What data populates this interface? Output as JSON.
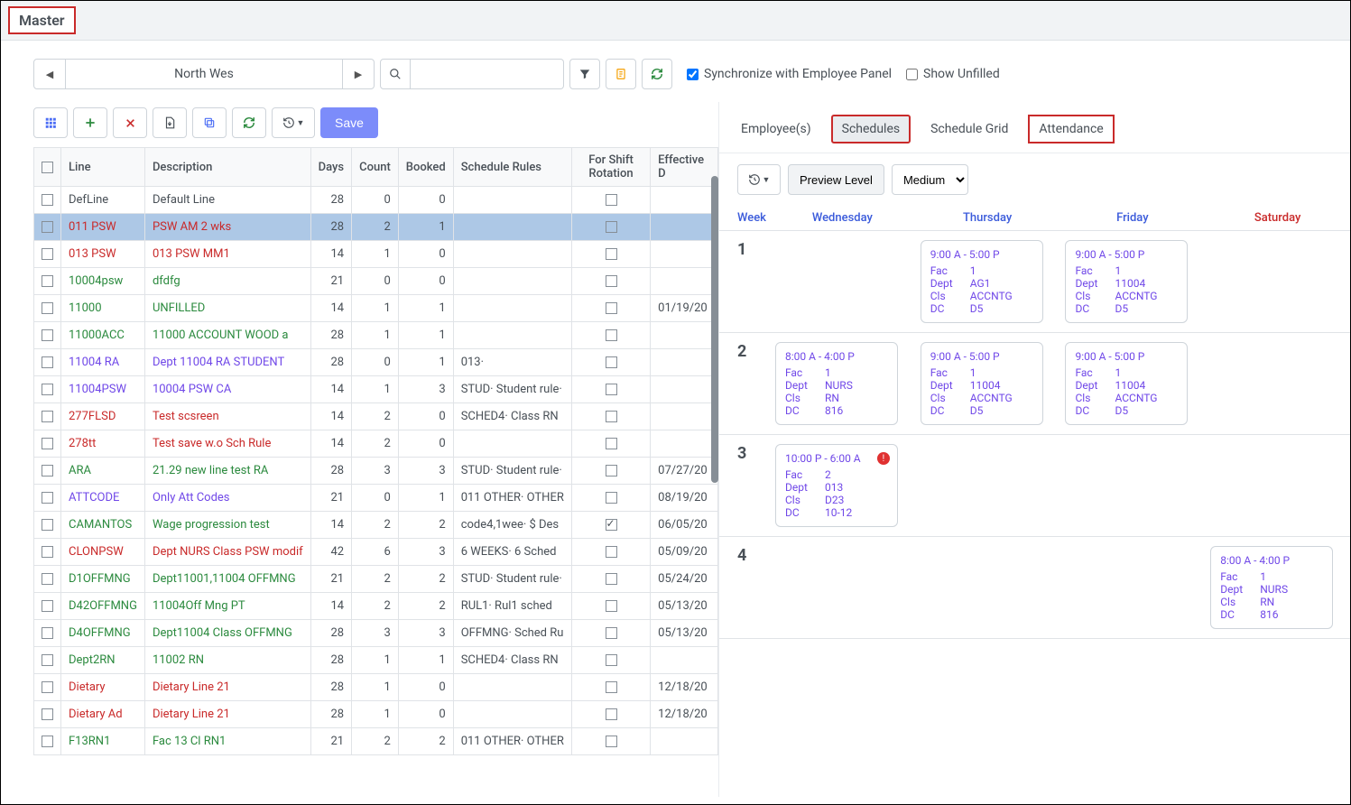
{
  "title": "Master",
  "site": "North Wes",
  "sync_label": "Synchronize with Employee Panel",
  "unfilled_label": "Show Unfilled",
  "save_label": "Save",
  "grid": {
    "headers": [
      "",
      "Line",
      "Description",
      "Days",
      "Count",
      "Booked",
      "Schedule Rules",
      "For Shift Rotation",
      "Effective D"
    ],
    "rows": [
      {
        "sel": false,
        "line": "DefLine",
        "desc": "Default Line",
        "days": 28,
        "count": 0,
        "booked": 0,
        "rules": "",
        "rot": false,
        "eff": "",
        "color": "default"
      },
      {
        "sel": true,
        "line": "011 PSW",
        "desc": "PSW AM 2 wks",
        "days": 28,
        "count": 2,
        "booked": 1,
        "rules": "",
        "rot": false,
        "eff": "",
        "color": "red"
      },
      {
        "sel": false,
        "line": "013 PSW",
        "desc": "013 PSW MM1",
        "days": 14,
        "count": 1,
        "booked": 0,
        "rules": "",
        "rot": false,
        "eff": "",
        "color": "red"
      },
      {
        "sel": false,
        "line": "10004psw",
        "desc": "dfdfg",
        "days": 21,
        "count": 0,
        "booked": 0,
        "rules": "",
        "rot": false,
        "eff": "",
        "color": "green"
      },
      {
        "sel": false,
        "line": "11000",
        "desc": "UNFILLED",
        "days": 14,
        "count": 1,
        "booked": 1,
        "rules": "",
        "rot": false,
        "eff": "01/19/20",
        "color": "green"
      },
      {
        "sel": false,
        "line": "11000ACC",
        "desc": "11000 ACCOUNT WOOD a",
        "days": 28,
        "count": 1,
        "booked": 1,
        "rules": "",
        "rot": false,
        "eff": "",
        "color": "green"
      },
      {
        "sel": false,
        "line": "11004 RA",
        "desc": "Dept 11004 RA STUDENT",
        "days": 28,
        "count": 0,
        "booked": 1,
        "rules": "013·",
        "rot": false,
        "eff": "",
        "color": "purple"
      },
      {
        "sel": false,
        "line": "11004PSW",
        "desc": "10004 PSW CA",
        "days": 14,
        "count": 1,
        "booked": 3,
        "rules": "STUD· Student rule·",
        "rot": false,
        "eff": "",
        "color": "purple"
      },
      {
        "sel": false,
        "line": "277FLSD",
        "desc": "Test scsreen",
        "days": 14,
        "count": 2,
        "booked": 0,
        "rules": "SCHED4· Class RN",
        "rot": false,
        "eff": "",
        "color": "red"
      },
      {
        "sel": false,
        "line": "278tt",
        "desc": "Test save w.o Sch Rule",
        "days": 14,
        "count": 2,
        "booked": 0,
        "rules": "",
        "rot": false,
        "eff": "",
        "color": "red"
      },
      {
        "sel": false,
        "line": "ARA",
        "desc": "21.29 new line test RA",
        "days": 28,
        "count": 3,
        "booked": 3,
        "rules": "STUD· Student rule·",
        "rot": false,
        "eff": "07/27/20",
        "color": "green"
      },
      {
        "sel": false,
        "line": "ATTCODE",
        "desc": "Only Att Codes",
        "days": 21,
        "count": 0,
        "booked": 1,
        "rules": "011 OTHER· OTHER",
        "rot": false,
        "eff": "08/19/20",
        "color": "purple"
      },
      {
        "sel": false,
        "line": "CAMANTOS",
        "desc": "Wage progression test",
        "days": 14,
        "count": 2,
        "booked": 2,
        "rules": "code4,1wee· $ Des",
        "rot": true,
        "eff": "06/05/20",
        "color": "green"
      },
      {
        "sel": false,
        "line": "CLONPSW",
        "desc": "Dept NURS Class PSW modif",
        "days": 42,
        "count": 6,
        "booked": 3,
        "rules": "6 WEEKS· 6 Sched",
        "rot": false,
        "eff": "05/09/20",
        "color": "red"
      },
      {
        "sel": false,
        "line": "D1OFFMNG",
        "desc": "Dept11001,11004 OFFMNG",
        "days": 21,
        "count": 2,
        "booked": 2,
        "rules": "STUD· Student rule·",
        "rot": false,
        "eff": "05/24/20",
        "color": "green"
      },
      {
        "sel": false,
        "line": "D42OFFMNG",
        "desc": "11004Off Mng PT",
        "days": 14,
        "count": 2,
        "booked": 2,
        "rules": "RUL1· Rul1 sched",
        "rot": false,
        "eff": "05/13/20",
        "color": "green"
      },
      {
        "sel": false,
        "line": "D4OFFMNG",
        "desc": "Dept11004 Class OFFMNG",
        "days": 28,
        "count": 3,
        "booked": 3,
        "rules": "OFFMNG· Sched Ru",
        "rot": false,
        "eff": "05/13/20",
        "color": "green"
      },
      {
        "sel": false,
        "line": "Dept2RN",
        "desc": "11002 RN",
        "days": 28,
        "count": 1,
        "booked": 1,
        "rules": "SCHED4· Class RN",
        "rot": false,
        "eff": "",
        "color": "green"
      },
      {
        "sel": false,
        "line": "Dietary",
        "desc": "Dietary Line 21",
        "days": 28,
        "count": 1,
        "booked": 0,
        "rules": "",
        "rot": false,
        "eff": "12/18/20",
        "color": "red"
      },
      {
        "sel": false,
        "line": "Dietary Ad",
        "desc": "Dietary Line 21",
        "days": 28,
        "count": 1,
        "booked": 0,
        "rules": "",
        "rot": false,
        "eff": "12/18/20",
        "color": "red"
      },
      {
        "sel": false,
        "line": "F13RN1",
        "desc": "Fac 13 Cl RN1",
        "days": 21,
        "count": 2,
        "booked": 2,
        "rules": "011 OTHER· OTHER",
        "rot": false,
        "eff": "",
        "color": "green"
      }
    ]
  },
  "tabs": [
    "Employee(s)",
    "Schedules",
    "Schedule Grid",
    "Attendance"
  ],
  "preview_label": "Preview Level",
  "preview_value": "Medium",
  "sched_headers": [
    "Week",
    "Wednesday",
    "Thursday",
    "Friday",
    "Saturday"
  ],
  "weeks": [
    {
      "num": "1",
      "cells": [
        null,
        {
          "time": "9:00 A - 5:00 P",
          "fac": "1",
          "dept": "AG1",
          "cls": "ACCNTG",
          "dc": "D5"
        },
        {
          "time": "9:00 A - 5:00 P",
          "fac": "1",
          "dept": "11004",
          "cls": "ACCNTG",
          "dc": "D5"
        },
        null
      ]
    },
    {
      "num": "2",
      "cells": [
        {
          "time": "8:00 A - 4:00 P",
          "fac": "1",
          "dept": "NURS",
          "cls": "RN",
          "dc": "816"
        },
        {
          "time": "9:00 A - 5:00 P",
          "fac": "1",
          "dept": "11004",
          "cls": "ACCNTG",
          "dc": "D5"
        },
        {
          "time": "9:00 A - 5:00 P",
          "fac": "1",
          "dept": "11004",
          "cls": "ACCNTG",
          "dc": "D5"
        },
        null
      ]
    },
    {
      "num": "3",
      "cells": [
        {
          "time": "10:00 P - 6:00 A",
          "fac": "2",
          "dept": "013",
          "cls": "D23",
          "dc": "10-12",
          "alert": true
        },
        null,
        null,
        null
      ]
    },
    {
      "num": "4",
      "cells": [
        null,
        null,
        null,
        {
          "time": "8:00 A - 4:00 P",
          "fac": "1",
          "dept": "NURS",
          "cls": "RN",
          "dc": "816"
        }
      ]
    }
  ],
  "labels": {
    "fac": "Fac",
    "dept": "Dept",
    "cls": "Cls",
    "dc": "DC"
  }
}
